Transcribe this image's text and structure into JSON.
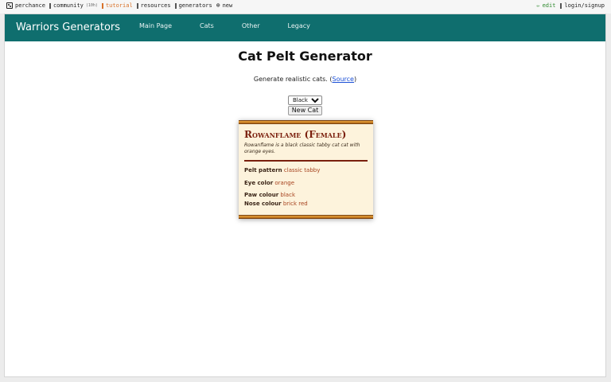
{
  "topbar": {
    "perchance": "perchance",
    "community": "community",
    "community_count": "(10h)",
    "tutorial": "tutorial",
    "resources": "resources",
    "generators": "generators",
    "new": "new",
    "edit": "edit",
    "login": "login/signup"
  },
  "nav": {
    "brand": "Warriors Generators",
    "links": [
      "Main Page",
      "Cats",
      "Other",
      "Legacy"
    ]
  },
  "page": {
    "title": "Cat Pelt Generator",
    "subtitle_prefix": "Generate realistic cats. (",
    "source_link": "Source",
    "subtitle_suffix": ")"
  },
  "controls": {
    "selected_color": "Black",
    "new_cat_label": "New Cat"
  },
  "cat": {
    "name": "Rowanflame (Female)",
    "description": "Rowanflame is a black classic tabby cat cat with orange eyes.",
    "stats": [
      {
        "label": "Pelt pattern",
        "value": "classic tabby"
      },
      {
        "label": "Eye color",
        "value": "orange"
      },
      {
        "label": "Paw colour",
        "value": "black"
      },
      {
        "label": "Nose colour",
        "value": "brick red"
      }
    ]
  },
  "colors": {
    "nav_bg": "#0f6e6e",
    "card_bg": "#fdf3dc",
    "card_accent": "#7a1f0d",
    "card_bar": "#d98a2b",
    "tutorial": "#d8722a",
    "edit": "#2f8a2f",
    "link": "#1a4fd6"
  }
}
